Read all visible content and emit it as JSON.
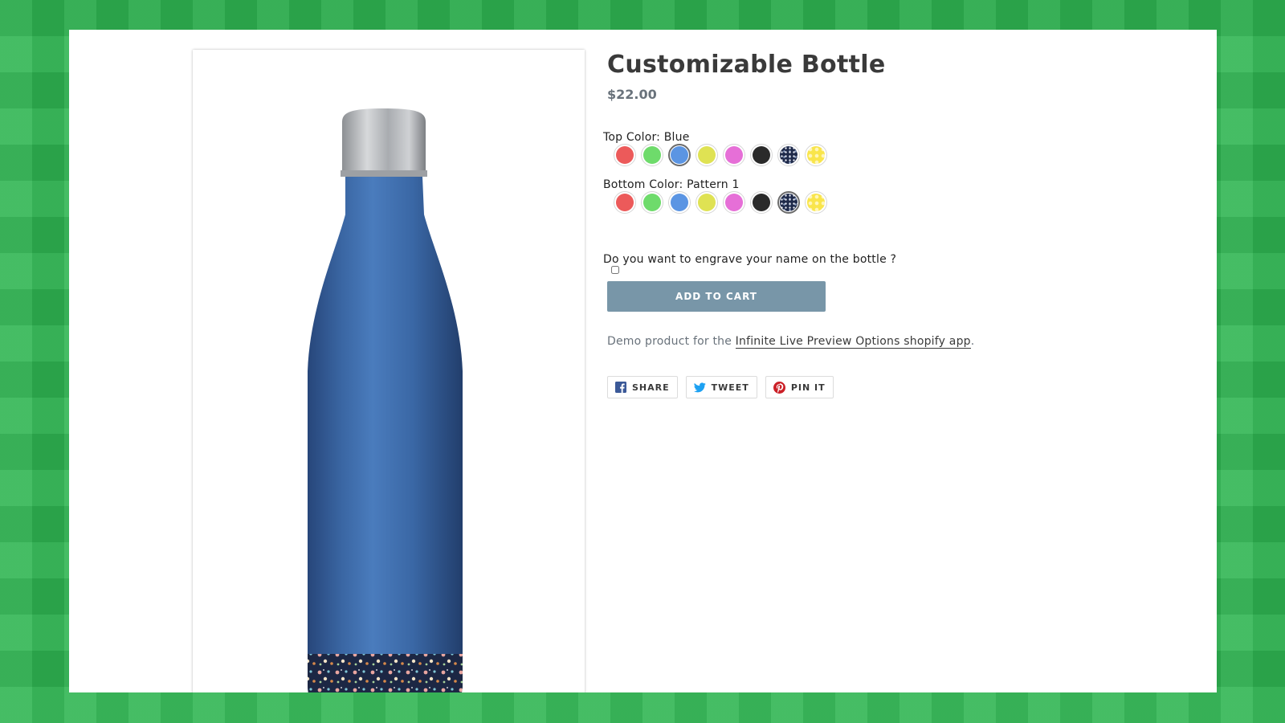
{
  "product": {
    "title": "Customizable Bottle",
    "price": "$22.00"
  },
  "options": {
    "top": {
      "label": "Top Color: Blue",
      "selected": "Blue",
      "swatches": [
        {
          "name": "Red",
          "color": "#ec5a5a"
        },
        {
          "name": "Green",
          "color": "#6edb6b"
        },
        {
          "name": "Blue",
          "color": "#5b95e3"
        },
        {
          "name": "Yellow",
          "color": "#dfe253"
        },
        {
          "name": "Pink",
          "color": "#e66fd7"
        },
        {
          "name": "Black",
          "color": "#2a2a2a"
        },
        {
          "name": "Pattern 1",
          "color": "#1f2a4a"
        },
        {
          "name": "Pattern 2",
          "color": "#f9e54b"
        }
      ]
    },
    "bottom": {
      "label": "Bottom Color: Pattern 1",
      "selected": "Pattern 1"
    },
    "engrave": {
      "label": "Do you want to engrave your name on the bottle ?",
      "checked": false
    }
  },
  "cart": {
    "button_label": "ADD TO CART"
  },
  "description": {
    "prefix": "Demo product for the ",
    "link_text": "Infinite Live Preview Options shopify app",
    "suffix": "."
  },
  "share": {
    "facebook": "SHARE",
    "twitter": "TWEET",
    "pinterest": "PIN IT"
  },
  "colors": {
    "background": "#2fb552",
    "bottle_body": "#3d6ba8",
    "cap": "#b9bcbf",
    "button": "#7896a8",
    "facebook": "#3b5998",
    "twitter": "#1da1f2",
    "pinterest": "#cb2027"
  },
  "icons": {
    "share": "facebook-icon",
    "tweet": "twitter-icon",
    "pin": "pinterest-icon"
  }
}
